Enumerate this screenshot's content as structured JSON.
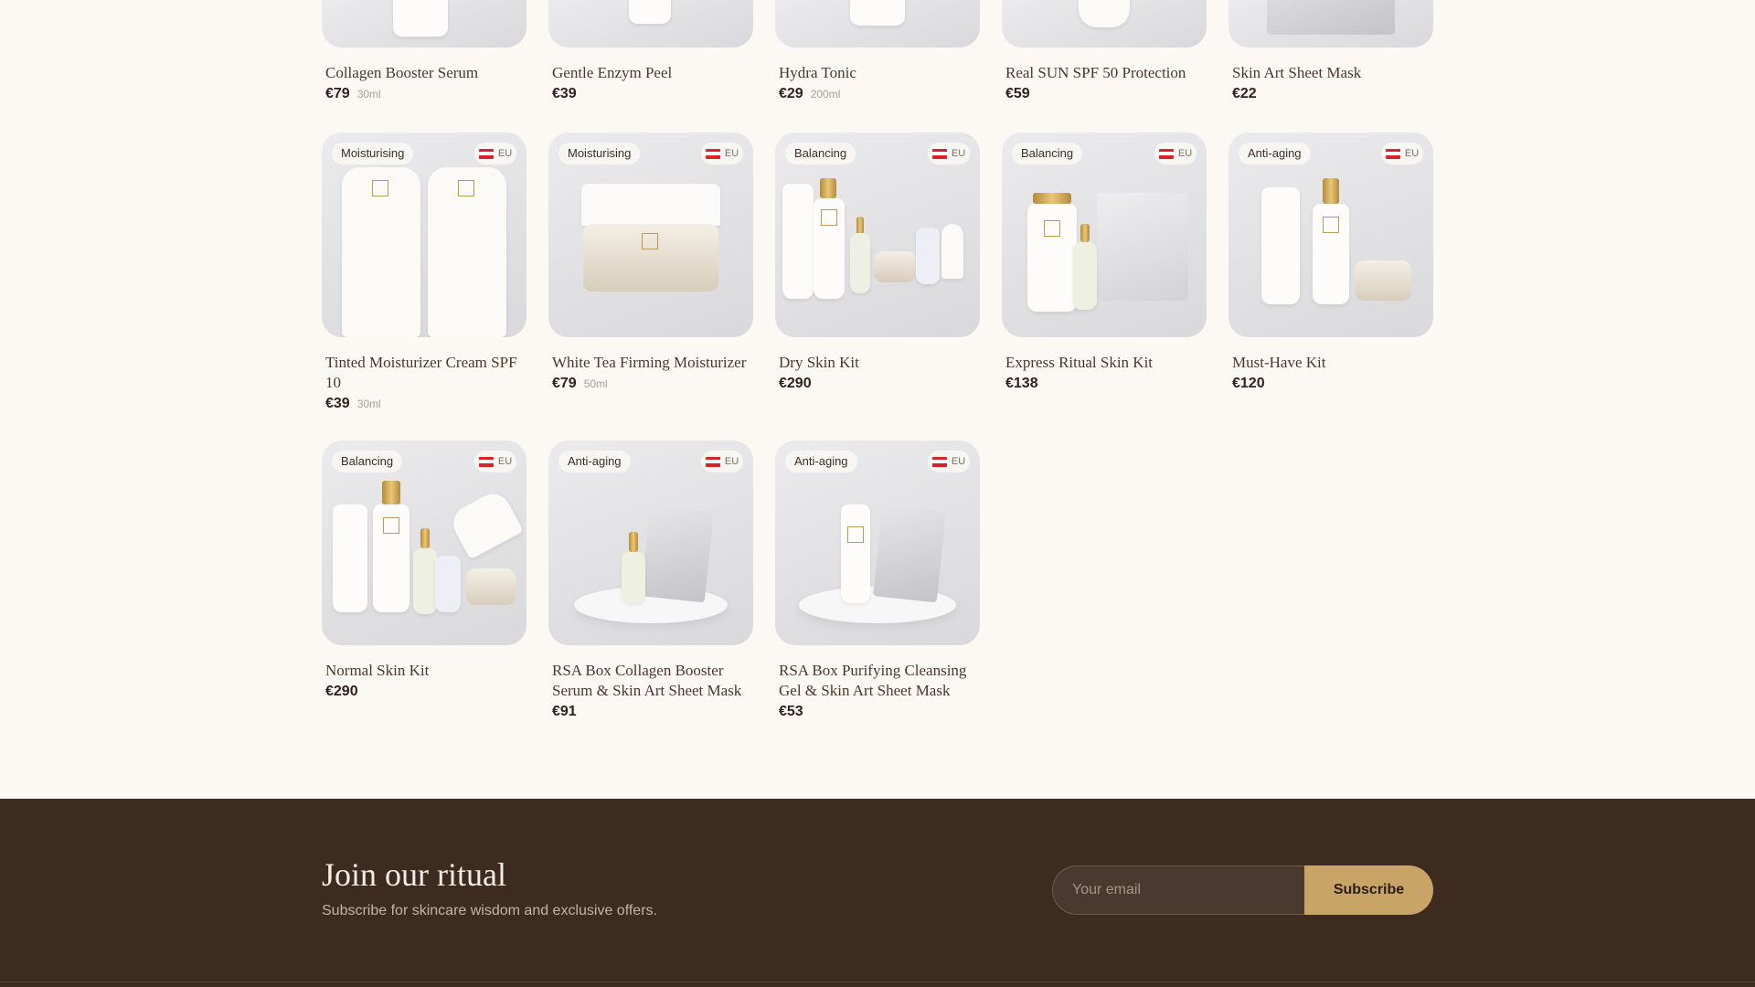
{
  "flag_code": "EU",
  "colors": {
    "accent": "#c8a566",
    "footer_bg": "#3d2b20",
    "page_bg": "#fcf9f4"
  },
  "row1": [
    {
      "name": "Collagen Booster Serum",
      "price": "€79",
      "size": "30ml"
    },
    {
      "name": "Gentle Enzym Peel",
      "price": "€39",
      "size": ""
    },
    {
      "name": "Hydra Tonic",
      "price": "€29",
      "size": "200ml"
    },
    {
      "name": "Real SUN SPF 50 Protection",
      "price": "€59",
      "size": ""
    },
    {
      "name": "Skin Art Sheet Mask",
      "price": "€22",
      "size": ""
    }
  ],
  "row2": [
    {
      "badge": "Moisturising",
      "name": "Tinted Moisturizer Cream SPF 10",
      "price": "€39",
      "size": "30ml"
    },
    {
      "badge": "Moisturising",
      "name": "White Tea Firming Moisturizer",
      "price": "€79",
      "size": "50ml"
    },
    {
      "badge": "Balancing",
      "name": "Dry Skin Kit",
      "price": "€290",
      "size": ""
    },
    {
      "badge": "Balancing",
      "name": "Express Ritual Skin Kit",
      "price": "€138",
      "size": ""
    },
    {
      "badge": "Anti-aging",
      "name": "Must-Have Kit",
      "price": "€120",
      "size": ""
    }
  ],
  "row3": [
    {
      "badge": "Balancing",
      "name": "Normal Skin Kit",
      "price": "€290",
      "size": ""
    },
    {
      "badge": "Anti-aging",
      "name": "RSA Box Collagen Booster Serum & Skin Art Sheet Mask",
      "price": "€91",
      "size": ""
    },
    {
      "badge": "Anti-aging",
      "name": "RSA Box Purifying Cleansing Gel & Skin Art Sheet Mask",
      "price": "€53",
      "size": ""
    }
  ],
  "footer": {
    "title": "Join our ritual",
    "subtitle": "Subscribe for skincare wisdom and exclusive offers.",
    "email_placeholder": "Your email",
    "subscribe_label": "Subscribe"
  }
}
